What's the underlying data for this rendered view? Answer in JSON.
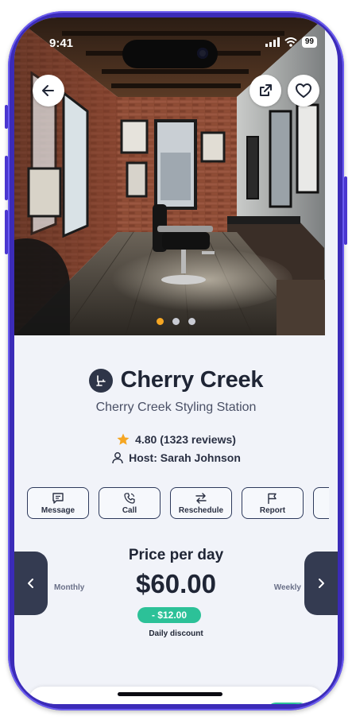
{
  "status_bar": {
    "time": "9:41",
    "battery": "99"
  },
  "hero": {
    "carousel_total": 3,
    "carousel_active": 1
  },
  "listing": {
    "title": "Cherry Creek",
    "subtitle": "Cherry Creek Styling Station",
    "rating_text": "4.80 (1323 reviews)",
    "host_text": "Host: Sarah Johnson"
  },
  "actions": [
    {
      "label": "Message",
      "icon": "message-icon"
    },
    {
      "label": "Call",
      "icon": "phone-icon"
    },
    {
      "label": "Reschedule",
      "icon": "swap-icon"
    },
    {
      "label": "Report",
      "icon": "flag-icon"
    }
  ],
  "pricing": {
    "title": "Price per day",
    "price": "$60.00",
    "left_label": "Monthly",
    "right_label": "Weekly",
    "discount_badge": "- $12.00",
    "discount_label": "Daily discount"
  },
  "colors": {
    "accent_green": "#2cc198",
    "star": "#f5a623",
    "dark": "#343b51",
    "frame": "#3b2bb8"
  }
}
